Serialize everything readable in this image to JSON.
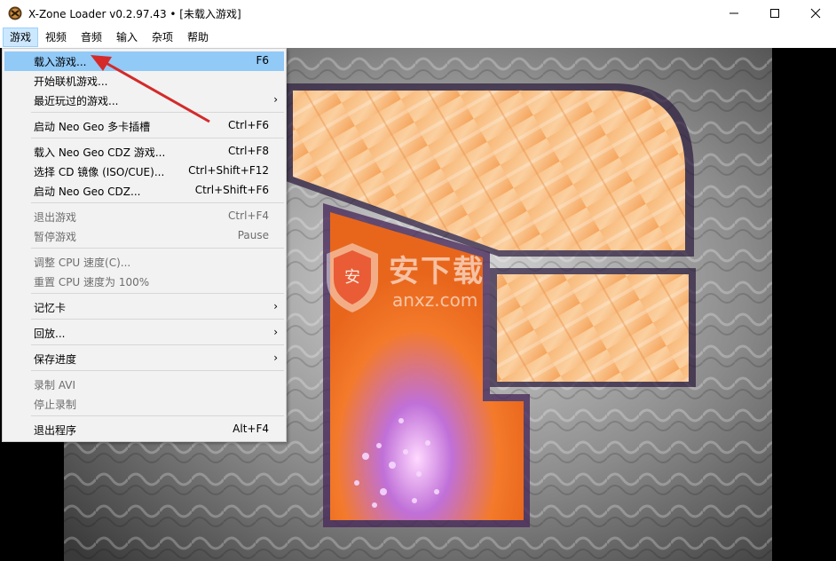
{
  "window": {
    "title": "X-Zone Loader v0.2.97.43 • [未载入游戏]",
    "controls": {
      "minimize": "─",
      "maximize": "☐",
      "close": "✕"
    }
  },
  "menubar": [
    "游戏",
    "视频",
    "音频",
    "输入",
    "杂项",
    "帮助"
  ],
  "menu": {
    "items": [
      {
        "label": "载入游戏...",
        "shortcut": "F6",
        "highlighted": true
      },
      {
        "label": "开始联机游戏..."
      },
      {
        "label": "最近玩过的游戏...",
        "submenu": "›"
      },
      {
        "label": "启动 Neo Geo 多卡插槽",
        "shortcut": "Ctrl+F6"
      },
      {
        "label": "载入 Neo Geo CDZ 游戏...",
        "shortcut": "Ctrl+F8"
      },
      {
        "label": "选择 CD 镜像 (ISO/CUE)...",
        "shortcut": "Ctrl+Shift+F12"
      },
      {
        "label": "启动 Neo Geo CDZ...",
        "shortcut": "Ctrl+Shift+F6"
      },
      {
        "label": "退出游戏",
        "shortcut": "Ctrl+F4",
        "disabled": true
      },
      {
        "label": "暂停游戏",
        "shortcut": "Pause",
        "disabled": true
      },
      {
        "label": "调整 CPU 速度(C)...",
        "disabled": true
      },
      {
        "label": "重置 CPU 速度为 100%",
        "disabled": true
      },
      {
        "label": "记忆卡",
        "submenu": "›"
      },
      {
        "label": "回放...",
        "submenu": "›"
      },
      {
        "label": "保存进度",
        "submenu": "›"
      },
      {
        "label": "录制 AVI",
        "disabled": true
      },
      {
        "label": "停止录制",
        "disabled": true
      },
      {
        "label": "退出程序",
        "shortcut": "Alt+F4"
      }
    ]
  },
  "watermark": {
    "text": "安下载",
    "subtext": "anxz.com",
    "shield": "安"
  },
  "colors": {
    "highlight": "#91c9f7",
    "menubar_active": "#cce8ff",
    "arrow": "#d42a2a",
    "logo_orange": "#f59a4a"
  }
}
